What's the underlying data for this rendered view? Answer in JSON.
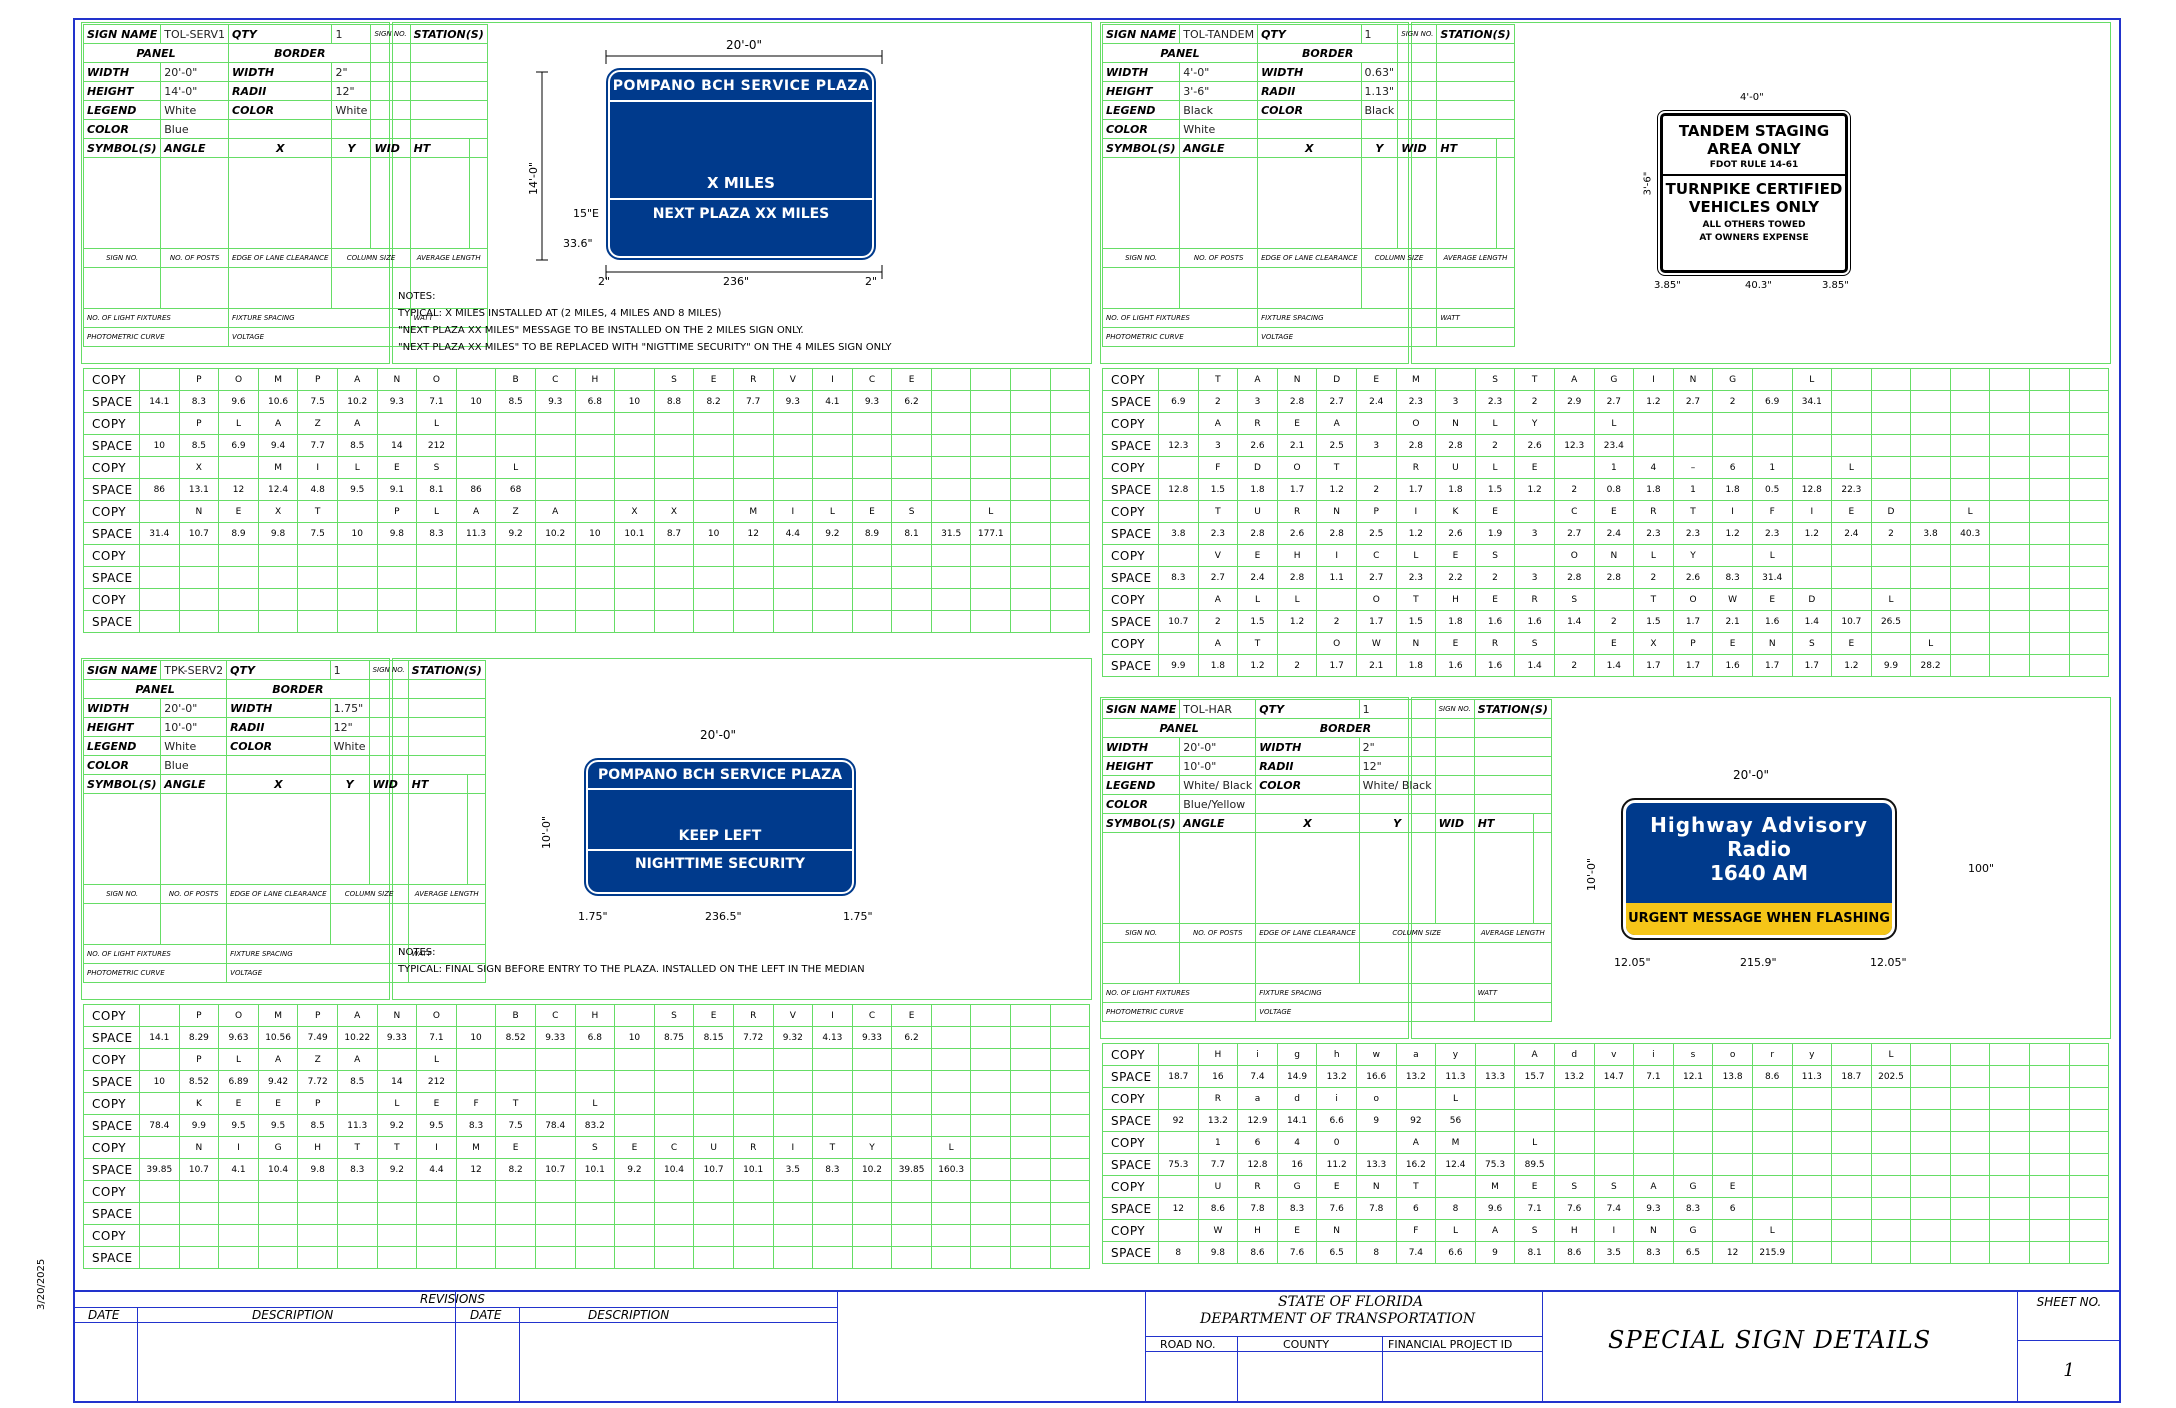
{
  "sign1": {
    "name": "TOL-SERV1",
    "qty": "1",
    "width": "20'-0\"",
    "height": "14'-0\"",
    "border_width": "2\"",
    "radii": "12\"",
    "legend": "White",
    "color": "Blue",
    "bcolor": "White",
    "line1": "POMPANO BCH SERVICE PLAZA",
    "line2": "X MILES",
    "line3": "NEXT PLAZA XX MILES",
    "dim_top": "20'-0\"",
    "dim_side": "14'-0\"",
    "dim_l": "2\"",
    "dim_mid": "236\"",
    "dim_r": "2\"",
    "dim_15e": "15\"E",
    "dim_336": "33.6\"",
    "notes": [
      "NOTES:",
      "TYPICAL: X MILES INSTALLED AT (2 MILES, 4 MILES AND 8 MILES)",
      "\"NEXT PLAZA XX MILES\" MESSAGE TO BE INSTALLED ON THE 2 MILES SIGN ONLY.",
      "\"NEXT PLAZA XX MILES\" TO BE REPLACED WITH \"NIGTTIME SECURITY\" ON THE 4 MILES SIGN ONLY"
    ]
  },
  "sign2": {
    "name": "TPK-SERV2",
    "qty": "1",
    "width": "20'-0\"",
    "height": "10'-0\"",
    "border_width": "1.75\"",
    "radii": "12\"",
    "legend": "White",
    "color": "Blue",
    "bcolor": "White",
    "line1": "POMPANO BCH SERVICE PLAZA",
    "line2": "KEEP LEFT",
    "line3": "NIGHTTIME SECURITY",
    "dim_top": "20'-0\"",
    "dim_side": "10'-0\"",
    "dim_l": "1.75\"",
    "dim_mid": "236.5\"",
    "dim_r": "1.75\"",
    "notes": [
      "NOTES:",
      "TYPICAL: FINAL SIGN BEFORE ENTRY TO THE PLAZA. INSTALLED ON THE LEFT IN THE MEDIAN"
    ]
  },
  "sign3": {
    "name": "TOL-TANDEM",
    "qty": "1",
    "width": "4'-0\"",
    "height": "3'-6\"",
    "border_width": "0.63\"",
    "radii": "1.13\"",
    "legend": "Black",
    "color": "White",
    "bcolor": "Black",
    "line1": "TANDEM STAGING",
    "line2": "AREA ONLY",
    "line3": "FDOT RULE 14-61",
    "line4": "TURNPIKE CERTIFIED",
    "line5": "VEHICLES ONLY",
    "line6": "ALL OTHERS TOWED",
    "line7": "AT OWNERS EXPENSE",
    "dim_top": "4'-0\"",
    "dim_side": "3'-6\"",
    "dim_l": "3.85\"",
    "dim_mid": "40.3\"",
    "dim_r": "3.85\""
  },
  "sign4": {
    "name": "TOL-HAR",
    "qty": "1",
    "width": "20'-0\"",
    "height": "10'-0\"",
    "border_width": "2\"",
    "radii": "12\"",
    "legend": "White/ Black",
    "color": "Blue/Yellow",
    "bcolor": "White/ Black",
    "line1": "Highway Advisory",
    "line2": "Radio",
    "line3": "1640 AM",
    "line4": "URGENT MESSAGE WHEN FLASHING",
    "dim_top": "20'-0\"",
    "dim_side": "10'-0\"",
    "dim_l": "12.05\"",
    "dim_mid": "215.9\"",
    "dim_r": "12.05\"",
    "dim_total": "100\""
  },
  "labels": {
    "sign_name": "SIGN NAME",
    "qty": "QTY",
    "sign_no": "SIGN NO.",
    "stations": "STATION(S)",
    "panel": "PANEL",
    "border": "BORDER",
    "width": "WIDTH",
    "height": "HEIGHT",
    "radii": "RADII",
    "legend": "LEGEND",
    "color": "COLOR",
    "symbols": "SYMBOL(S)",
    "angle": "ANGLE",
    "x": "X",
    "y": "Y",
    "wid": "WID",
    "ht": "HT",
    "sign_no2": "SIGN NO.",
    "no_posts": "NO. OF POSTS",
    "edge": "EDGE OF LANE CLEARANCE",
    "colsize": "COLUMN SIZE",
    "avg": "AVERAGE LENGTH",
    "fixtures": "NO. OF LIGHT FIXTURES",
    "spacing": "FIXTURE SPACING",
    "watt": "WATT",
    "photo": "PHOTOMETRIC CURVE",
    "voltage": "VOLTAGE",
    "copy": "COPY",
    "space": "SPACE"
  },
  "tables": {
    "t1": [
      {
        "copy": [
          "P",
          "O",
          "M",
          "P",
          "A",
          "N",
          "O",
          "",
          "B",
          "C",
          "H",
          "",
          "S",
          "E",
          "R",
          "V",
          "I",
          "C",
          "E"
        ],
        "space": [
          "14.1",
          "8.3",
          "9.6",
          "10.6",
          "7.5",
          "10.2",
          "9.3",
          "7.1",
          "10",
          "8.5",
          "9.3",
          "6.8",
          "10",
          "8.8",
          "8.2",
          "7.7",
          "9.3",
          "4.1",
          "9.3",
          "6.2"
        ]
      },
      {
        "copy": [
          "P",
          "L",
          "A",
          "Z",
          "A",
          "",
          "L"
        ],
        "space": [
          "10",
          "8.5",
          "6.9",
          "9.4",
          "7.7",
          "8.5",
          "14",
          "212"
        ]
      },
      {
        "copy": [
          "X",
          "",
          "M",
          "I",
          "L",
          "E",
          "S",
          "",
          "L"
        ],
        "space": [
          "86",
          "13.1",
          "12",
          "12.4",
          "4.8",
          "9.5",
          "9.1",
          "8.1",
          "86",
          "68"
        ]
      },
      {
        "copy": [
          "N",
          "E",
          "X",
          "T",
          "",
          "P",
          "L",
          "A",
          "Z",
          "A",
          "",
          "X",
          "X",
          "",
          "M",
          "I",
          "L",
          "E",
          "S",
          "",
          "L"
        ],
        "space": [
          "31.4",
          "10.7",
          "8.9",
          "9.8",
          "7.5",
          "10",
          "9.8",
          "8.3",
          "11.3",
          "9.2",
          "10.2",
          "10",
          "10.1",
          "8.7",
          "10",
          "12",
          "4.4",
          "9.2",
          "8.9",
          "8.1",
          "31.5",
          "177.1"
        ]
      },
      {
        "copy": [],
        "space": []
      },
      {
        "copy": [],
        "space": []
      }
    ],
    "t2": [
      {
        "copy": [
          "T",
          "A",
          "N",
          "D",
          "E",
          "M",
          "",
          "S",
          "T",
          "A",
          "G",
          "I",
          "N",
          "G",
          "",
          "L"
        ],
        "space": [
          "6.9",
          "2",
          "3",
          "2.8",
          "2.7",
          "2.4",
          "2.3",
          "3",
          "2.3",
          "2",
          "2.9",
          "2.7",
          "1.2",
          "2.7",
          "2",
          "6.9",
          "34.1"
        ]
      },
      {
        "copy": [
          "A",
          "R",
          "E",
          "A",
          "",
          "O",
          "N",
          "L",
          "Y",
          "",
          "L"
        ],
        "space": [
          "12.3",
          "3",
          "2.6",
          "2.1",
          "2.5",
          "3",
          "2.8",
          "2.8",
          "2",
          "2.6",
          "12.3",
          "23.4"
        ]
      },
      {
        "copy": [
          "F",
          "D",
          "O",
          "T",
          "",
          "R",
          "U",
          "L",
          "E",
          "",
          "1",
          "4",
          "–",
          "6",
          "1",
          "",
          "L"
        ],
        "space": [
          "12.8",
          "1.5",
          "1.8",
          "1.7",
          "1.2",
          "2",
          "1.7",
          "1.8",
          "1.5",
          "1.2",
          "2",
          "0.8",
          "1.8",
          "1",
          "1.8",
          "0.5",
          "12.8",
          "22.3"
        ]
      },
      {
        "copy": [
          "T",
          "U",
          "R",
          "N",
          "P",
          "I",
          "K",
          "E",
          "",
          "C",
          "E",
          "R",
          "T",
          "I",
          "F",
          "I",
          "E",
          "D",
          "",
          "L"
        ],
        "space": [
          "3.8",
          "2.3",
          "2.8",
          "2.6",
          "2.8",
          "2.5",
          "1.2",
          "2.6",
          "1.9",
          "3",
          "2.7",
          "2.4",
          "2.3",
          "2.3",
          "1.2",
          "2.3",
          "1.2",
          "2.4",
          "2",
          "3.8",
          "40.3"
        ]
      },
      {
        "copy": [
          "V",
          "E",
          "H",
          "I",
          "C",
          "L",
          "E",
          "S",
          "",
          "O",
          "N",
          "L",
          "Y",
          "",
          "L"
        ],
        "space": [
          "8.3",
          "2.7",
          "2.4",
          "2.8",
          "1.1",
          "2.7",
          "2.3",
          "2.2",
          "2",
          "3",
          "2.8",
          "2.8",
          "2",
          "2.6",
          "8.3",
          "31.4"
        ]
      },
      {
        "copy": [
          "A",
          "L",
          "L",
          "",
          "O",
          "T",
          "H",
          "E",
          "R",
          "S",
          "",
          "T",
          "O",
          "W",
          "E",
          "D",
          "",
          "L"
        ],
        "space": [
          "10.7",
          "2",
          "1.5",
          "1.2",
          "2",
          "1.7",
          "1.5",
          "1.8",
          "1.6",
          "1.6",
          "1.4",
          "2",
          "1.5",
          "1.7",
          "2.1",
          "1.6",
          "1.4",
          "10.7",
          "26.5"
        ]
      },
      {
        "copy": [
          "A",
          "T",
          "",
          "O",
          "W",
          "N",
          "E",
          "R",
          "S",
          "",
          "E",
          "X",
          "P",
          "E",
          "N",
          "S",
          "E",
          "",
          "L"
        ],
        "space": [
          "9.9",
          "1.8",
          "1.2",
          "2",
          "1.7",
          "2.1",
          "1.8",
          "1.6",
          "1.6",
          "1.4",
          "2",
          "1.4",
          "1.7",
          "1.7",
          "1.6",
          "1.7",
          "1.7",
          "1.2",
          "9.9",
          "28.2"
        ]
      }
    ],
    "t3": [
      {
        "copy": [
          "P",
          "O",
          "M",
          "P",
          "A",
          "N",
          "O",
          "",
          "B",
          "C",
          "H",
          "",
          "S",
          "E",
          "R",
          "V",
          "I",
          "C",
          "E"
        ],
        "space": [
          "14.1",
          "8.29",
          "9.63",
          "10.56",
          "7.49",
          "10.22",
          "9.33",
          "7.1",
          "10",
          "8.52",
          "9.33",
          "6.8",
          "10",
          "8.75",
          "8.15",
          "7.72",
          "9.32",
          "4.13",
          "9.33",
          "6.2"
        ]
      },
      {
        "copy": [
          "P",
          "L",
          "A",
          "Z",
          "A",
          "",
          "L"
        ],
        "space": [
          "10",
          "8.52",
          "6.89",
          "9.42",
          "7.72",
          "8.5",
          "14",
          "212"
        ]
      },
      {
        "copy": [
          "K",
          "E",
          "E",
          "P",
          "",
          "L",
          "E",
          "F",
          "T",
          "",
          "L"
        ],
        "space": [
          "78.4",
          "9.9",
          "9.5",
          "9.5",
          "8.5",
          "11.3",
          "9.2",
          "9.5",
          "8.3",
          "7.5",
          "78.4",
          "83.2"
        ]
      },
      {
        "copy": [
          "N",
          "I",
          "G",
          "H",
          "T",
          "T",
          "I",
          "M",
          "E",
          "",
          "S",
          "E",
          "C",
          "U",
          "R",
          "I",
          "T",
          "Y",
          "",
          "L"
        ],
        "space": [
          "39.85",
          "10.7",
          "4.1",
          "10.4",
          "9.8",
          "8.3",
          "9.2",
          "4.4",
          "12",
          "8.2",
          "10.7",
          "10.1",
          "9.2",
          "10.4",
          "10.7",
          "10.1",
          "3.5",
          "8.3",
          "10.2",
          "39.85",
          "160.3"
        ]
      },
      {
        "copy": [],
        "space": []
      },
      {
        "copy": [],
        "space": []
      }
    ],
    "t4": [
      {
        "copy": [
          "H",
          "i",
          "g",
          "h",
          "w",
          "a",
          "y",
          "",
          "A",
          "d",
          "v",
          "i",
          "s",
          "o",
          "r",
          "y",
          "",
          "L"
        ],
        "space": [
          "18.7",
          "16",
          "7.4",
          "14.9",
          "13.2",
          "16.6",
          "13.2",
          "11.3",
          "13.3",
          "15.7",
          "13.2",
          "14.7",
          "7.1",
          "12.1",
          "13.8",
          "8.6",
          "11.3",
          "18.7",
          "202.5"
        ]
      },
      {
        "copy": [
          "R",
          "a",
          "d",
          "i",
          "o",
          "",
          "L"
        ],
        "space": [
          "92",
          "13.2",
          "12.9",
          "14.1",
          "6.6",
          "9",
          "92",
          "56"
        ]
      },
      {
        "copy": [
          "1",
          "6",
          "4",
          "0",
          "",
          "A",
          "M",
          "",
          "L"
        ],
        "space": [
          "75.3",
          "7.7",
          "12.8",
          "16",
          "11.2",
          "13.3",
          "16.2",
          "12.4",
          "75.3",
          "89.5"
        ]
      },
      {
        "copy": [
          "U",
          "R",
          "G",
          "E",
          "N",
          "T",
          "",
          "M",
          "E",
          "S",
          "S",
          "A",
          "G",
          "E"
        ],
        "space": [
          "12",
          "8.6",
          "7.8",
          "8.3",
          "7.6",
          "7.8",
          "6",
          "8",
          "9.6",
          "7.1",
          "7.6",
          "7.4",
          "9.3",
          "8.3",
          "6"
        ]
      },
      {
        "copy": [
          "W",
          "H",
          "E",
          "N",
          "",
          "F",
          "L",
          "A",
          "S",
          "H",
          "I",
          "N",
          "G",
          "",
          "L"
        ],
        "space": [
          "8",
          "9.8",
          "8.6",
          "7.6",
          "6.5",
          "8",
          "7.4",
          "6.6",
          "9",
          "8.1",
          "8.6",
          "3.5",
          "8.3",
          "6.5",
          "12",
          "215.9"
        ]
      }
    ]
  },
  "title_block": {
    "revisions": "REVISIONS",
    "date": "DATE",
    "description": "DESCRIPTION",
    "state": "STATE OF FLORIDA",
    "dept": "DEPARTMENT OF TRANSPORTATION",
    "road_no": "ROAD NO.",
    "county": "COUNTY",
    "fpid": "FINANCIAL PROJECT ID",
    "title": "SPECIAL SIGN DETAILS",
    "sheet_no_label": "SHEET NO.",
    "sheet_no": "1",
    "side_date": "3/20/2025"
  },
  "colors": {
    "sign_blue": "#003a8c",
    "grid_green": "#66dd66",
    "frame_blue": "#2233cc",
    "har_yellow": "#f5c518"
  }
}
